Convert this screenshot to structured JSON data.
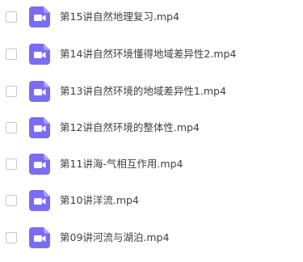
{
  "files": [
    {
      "name": "第15讲自然地理复习.mp4",
      "checked": false,
      "icon": "video-file-icon"
    },
    {
      "name": "第14讲自然环境懂得地域差异性2.mp4",
      "checked": false,
      "icon": "video-file-icon"
    },
    {
      "name": "第13讲自然环境的地域差异性1.mp4",
      "checked": false,
      "icon": "video-file-icon"
    },
    {
      "name": "第12讲自然环境的整体性.mp4",
      "checked": false,
      "icon": "video-file-icon"
    },
    {
      "name": "第11讲海-气相互作用.mp4",
      "checked": false,
      "icon": "video-file-icon"
    },
    {
      "name": "第10讲洋流.mp4",
      "checked": false,
      "icon": "video-file-icon"
    },
    {
      "name": "第09讲河流与湖泊.mp4",
      "checked": false,
      "icon": "video-file-icon"
    }
  ],
  "colors": {
    "icon_accent": "#7B6CF6",
    "text": "#3f3f3f",
    "checkbox_border": "#c9c9c9"
  }
}
